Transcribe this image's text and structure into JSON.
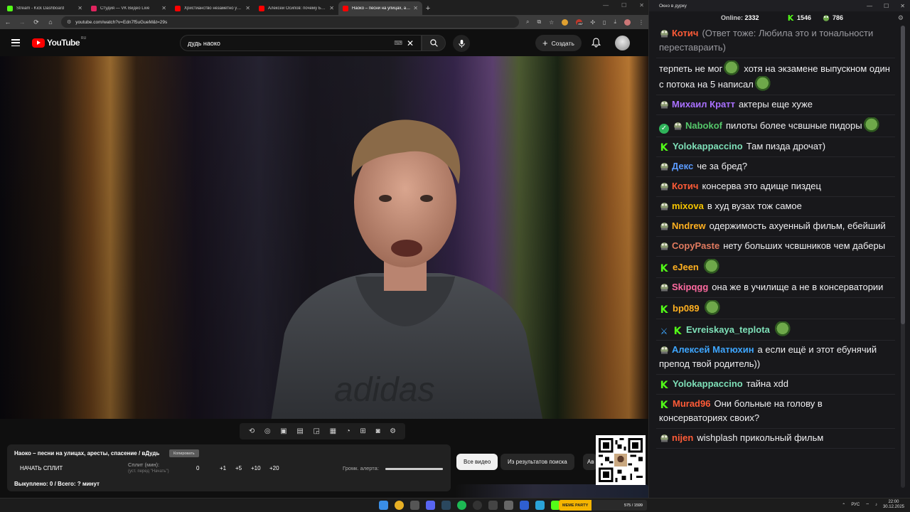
{
  "browser": {
    "tabs": [
      {
        "label": "Stream - Kick Dashboard",
        "color": "#53fc18",
        "active": false
      },
      {
        "label": "Студия — VK Видео Live",
        "color": "#e0245e",
        "active": false
      },
      {
        "label": "Христианство незаметно укоре…",
        "color": "#ff0000",
        "active": false
      },
      {
        "label": "Алексей Осипов: почему Бог …",
        "color": "#ff0000",
        "active": false
      },
      {
        "label": "Наоко – песни на улицах, аре…",
        "color": "#ff0000",
        "active": true
      }
    ],
    "url": "youtube.com/watch?v=Edn7f5uGueM&t=29s",
    "ext_badge": "467"
  },
  "youtube": {
    "logo_text": "YouTube",
    "region": "RU",
    "search_value": "дудь наоко",
    "create_label": "Создать"
  },
  "info": {
    "title": "Наоко – песни на улицах, аресты, спасение / вДудь",
    "copy_label": "Копировать",
    "split_button": "НАЧАТЬ СПЛИТ",
    "split_label": "Сплит (мин):",
    "split_hint": "(уст. перед \"Начать\")",
    "split_values": [
      "0",
      "+1",
      "+5",
      "+10",
      "+20"
    ],
    "alert_label": "Громк. алерта:",
    "alert_volume": 1.0,
    "bought": "Выкуплено: 0 / Всего: ? минут"
  },
  "chips": {
    "all": "Все видео",
    "search": "Из результатов поиска",
    "more": "Ав"
  },
  "chat": {
    "window_title": "Окно в дурку",
    "online_label": "Online:",
    "online_count": "2332",
    "kick_count": "1546",
    "other_count": "786",
    "colors": {
      "kick": "#53fc18",
      "frog": "#6ea84a"
    },
    "messages": [
      {
        "user": "Котич",
        "color": "#ff5b37",
        "badges": [
          "frog"
        ],
        "text": "(Ответ тоже: Любила это и тональности переставраить)",
        "dim": true
      },
      {
        "user": "",
        "color": "#fff",
        "badges": [],
        "text": "терпеть не мог",
        "text2": "хотя на экзамене выпускном один с потока на 5 написал",
        "emotes": 2
      },
      {
        "user": "Михаил Кратт",
        "color": "#a970ff",
        "badges": [
          "frog"
        ],
        "text": "актеры еще хуже"
      },
      {
        "user": "Nabokof",
        "color": "#55c76a",
        "badges": [
          "verified",
          "frog"
        ],
        "text": "пилоты более чсвшные пидоры",
        "emotes": 1
      },
      {
        "user": "Yolokappaccino",
        "color": "#7ee0b8",
        "badges": [
          "kick"
        ],
        "text": "Там пизда дрочат)"
      },
      {
        "user": "Декс",
        "color": "#5b9bff",
        "badges": [
          "frog"
        ],
        "text": "че за бред?"
      },
      {
        "user": "Котич",
        "color": "#ff5b37",
        "badges": [
          "frog"
        ],
        "text": "консерва это адище пиздец"
      },
      {
        "user": "mixova",
        "color": "#f5c400",
        "badges": [
          "frog"
        ],
        "text": "в худ вузах тож самое"
      },
      {
        "user": "Nndrew",
        "color": "#ffb020",
        "badges": [
          "frog"
        ],
        "text": "одержимость ахуенный фильм, ебейший"
      },
      {
        "user": "CopyPaste",
        "color": "#e07a5f",
        "badges": [
          "frog"
        ],
        "text": "нету больших чсвшников чем даберы"
      },
      {
        "user": "eJeen",
        "color": "#ffb020",
        "badges": [
          "kick"
        ],
        "text": "",
        "emotes": 1
      },
      {
        "user": "Skipqgg",
        "color": "#ff6aa0",
        "badges": [
          "frog"
        ],
        "text": "она же в училище а не в консерватории"
      },
      {
        "user": "bp089",
        "color": "#ffb020",
        "badges": [
          "kick"
        ],
        "text": "",
        "emotes": 1
      },
      {
        "user": "Evreiskaya_teplota",
        "color": "#7ee0b8",
        "badges": [
          "sword",
          "kick"
        ],
        "text": "",
        "emotes": 1
      },
      {
        "user": "Алексей Матюхин",
        "color": "#3ea6ff",
        "badges": [
          "frog"
        ],
        "text": "а если ещё и этот ебунячий препод твой родитель))"
      },
      {
        "user": "Yolokappaccino",
        "color": "#7ee0b8",
        "badges": [
          "kick"
        ],
        "text": "тайна xdd"
      },
      {
        "user": "Murad96",
        "color": "#ff5b37",
        "badges": [
          "kick"
        ],
        "text": "Они больные на голову в консерваториях своих?"
      },
      {
        "user": "nijen",
        "color": "#ff5b37",
        "badges": [
          "frog"
        ],
        "text": "wishplash прикольный фильм"
      }
    ]
  },
  "taskbar": {
    "meme_label": "MEME PARTY",
    "meme_count": "575 / 1599",
    "lang": "РУС",
    "time": "22:00",
    "date": "30.12.2025"
  }
}
